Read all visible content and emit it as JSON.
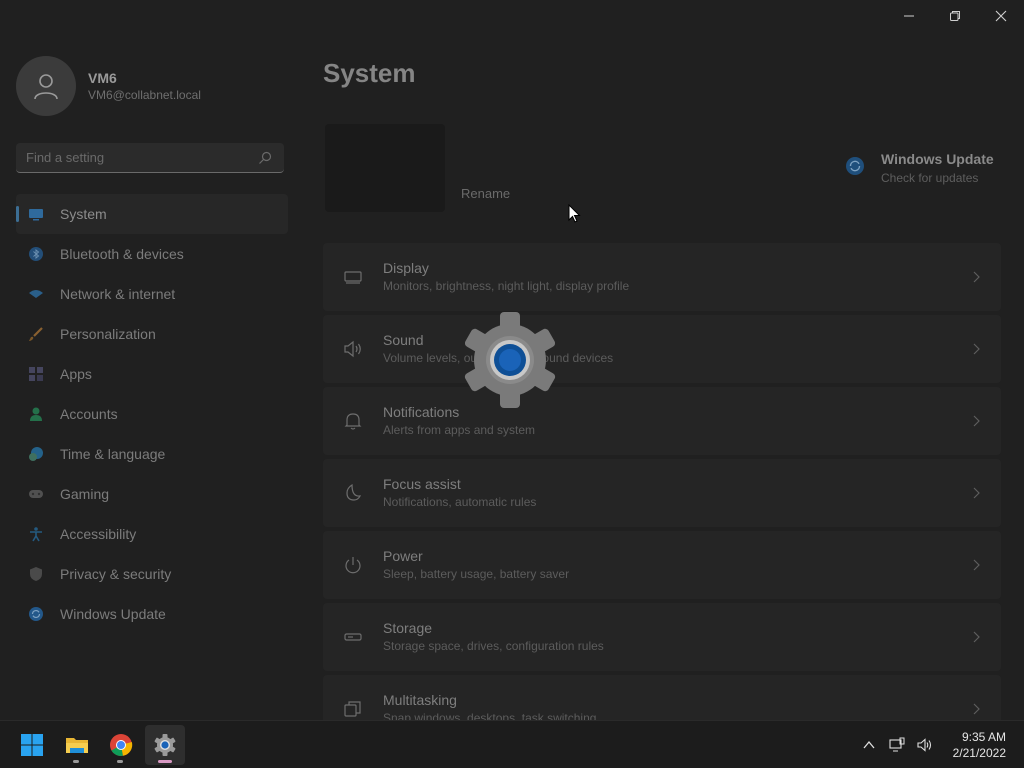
{
  "window": {
    "controls": {
      "minimize": "minimize",
      "restore": "restore",
      "close": "close"
    }
  },
  "profile": {
    "name": "VM6",
    "email": "VM6@collabnet.local"
  },
  "search": {
    "placeholder": "Find a setting"
  },
  "sidebar": {
    "items": [
      {
        "label": "System",
        "icon": "monitor-icon",
        "selected": true,
        "color": "#3a7ab5"
      },
      {
        "label": "Bluetooth & devices",
        "icon": "bluetooth-icon",
        "selected": false,
        "color": "#2f6fb0"
      },
      {
        "label": "Network & internet",
        "icon": "wifi-icon",
        "selected": false,
        "color": "#3a7fb8"
      },
      {
        "label": "Personalization",
        "icon": "brush-icon",
        "selected": false,
        "color": "#b07a3a"
      },
      {
        "label": "Apps",
        "icon": "apps-icon",
        "selected": false,
        "color": "#5a5a7a"
      },
      {
        "label": "Accounts",
        "icon": "person-icon",
        "selected": false,
        "color": "#2f8f5f"
      },
      {
        "label": "Time & language",
        "icon": "globe-clock-icon",
        "selected": false,
        "color": "#2f7fa8"
      },
      {
        "label": "Gaming",
        "icon": "gamepad-icon",
        "selected": false,
        "color": "#6a6a6a"
      },
      {
        "label": "Accessibility",
        "icon": "accessibility-icon",
        "selected": false,
        "color": "#2f6f9f"
      },
      {
        "label": "Privacy & security",
        "icon": "shield-icon",
        "selected": false,
        "color": "#5a5a5a"
      },
      {
        "label": "Windows Update",
        "icon": "update-icon",
        "selected": false,
        "color": "#2f6fb0"
      }
    ]
  },
  "main": {
    "title": "System",
    "rename_label": "Rename",
    "windows_update": {
      "title": "Windows Update",
      "subtitle": "Check for updates"
    },
    "settings": [
      {
        "title": "Display",
        "description": "Monitors, brightness, night light, display profile",
        "icon": "display-icon"
      },
      {
        "title": "Sound",
        "description": "Volume levels, output, input, sound devices",
        "icon": "speaker-icon"
      },
      {
        "title": "Notifications",
        "description": "Alerts from apps and system",
        "icon": "bell-icon"
      },
      {
        "title": "Focus assist",
        "description": "Notifications, automatic rules",
        "icon": "moon-icon"
      },
      {
        "title": "Power",
        "description": "Sleep, battery usage, battery saver",
        "icon": "power-icon"
      },
      {
        "title": "Storage",
        "description": "Storage space, drives, configuration rules",
        "icon": "storage-icon"
      },
      {
        "title": "Multitasking",
        "description": "Snap windows, desktops, task switching",
        "icon": "multitasking-icon"
      }
    ]
  },
  "loading": {
    "icon": "settings-gear-loading-icon"
  },
  "taskbar": {
    "apps": [
      {
        "name": "start",
        "icon": "windows-logo-icon"
      },
      {
        "name": "file-explorer",
        "icon": "folder-icon"
      },
      {
        "name": "chrome",
        "icon": "chrome-icon"
      },
      {
        "name": "settings",
        "icon": "settings-gear-icon",
        "active": true
      }
    ],
    "tray": {
      "time": "9:35 AM",
      "date": "2/21/2022"
    }
  },
  "colors": {
    "accent": "#0063b1",
    "background": "#202020",
    "taskbar": "#1c1c1c"
  }
}
